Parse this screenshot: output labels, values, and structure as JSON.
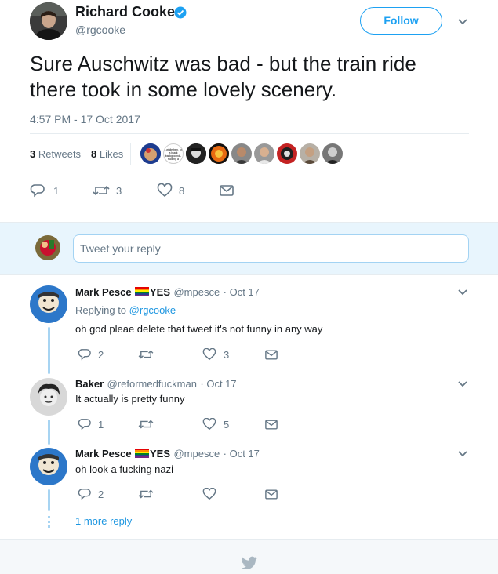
{
  "tweet": {
    "author_name": "Richard Cooke",
    "author_handle": "@rgcooke",
    "follow_label": "Follow",
    "text_line1": "Sure Auschwitz was bad - but the train ride",
    "text_line2": "there took in some lovely scenery.",
    "timestamp": "4:57 PM - 17 Oct 2017",
    "retweets_count": "3",
    "retweets_label": "Retweets",
    "likes_count": "8",
    "likes_label": "Likes",
    "action_replies": "1",
    "action_retweets": "3",
    "action_likes": "8",
    "liker_avatar_text": "...while ben, on a black background - fucking a"
  },
  "reply_box": {
    "placeholder": "Tweet your reply"
  },
  "replies": [
    {
      "name": "Mark Pesce",
      "name_suffix": "YES",
      "handle": "@mpesce",
      "time": "· Oct 17",
      "replying_prefix": "Replying to",
      "replying_handle": "@rgcooke",
      "text": "oh god pleae delete that tweet it's not funny in any way",
      "reply_count": "2",
      "retweet_count": "",
      "like_count": "3"
    },
    {
      "name": "Baker",
      "handle": "@reformedfuckman",
      "time": "· Oct 17",
      "text": "It actually is pretty funny",
      "reply_count": "1",
      "retweet_count": "",
      "like_count": "5"
    },
    {
      "name": "Mark Pesce",
      "name_suffix": "YES",
      "handle": "@mpesce",
      "time": "· Oct 17",
      "text": "oh look a fucking nazi",
      "reply_count": "2",
      "retweet_count": "",
      "like_count": ""
    }
  ],
  "more_replies_label": "1 more reply",
  "colors": {
    "accent": "#1da1f2",
    "link": "#1b95e0",
    "muted": "#657786",
    "divider": "#e6ecf0",
    "thread_line": "#a7d4f2"
  },
  "icons": [
    "verified-badge-icon",
    "chevron-down-icon",
    "reply-icon",
    "retweet-icon",
    "heart-icon",
    "message-icon",
    "twitter-bird-icon"
  ]
}
